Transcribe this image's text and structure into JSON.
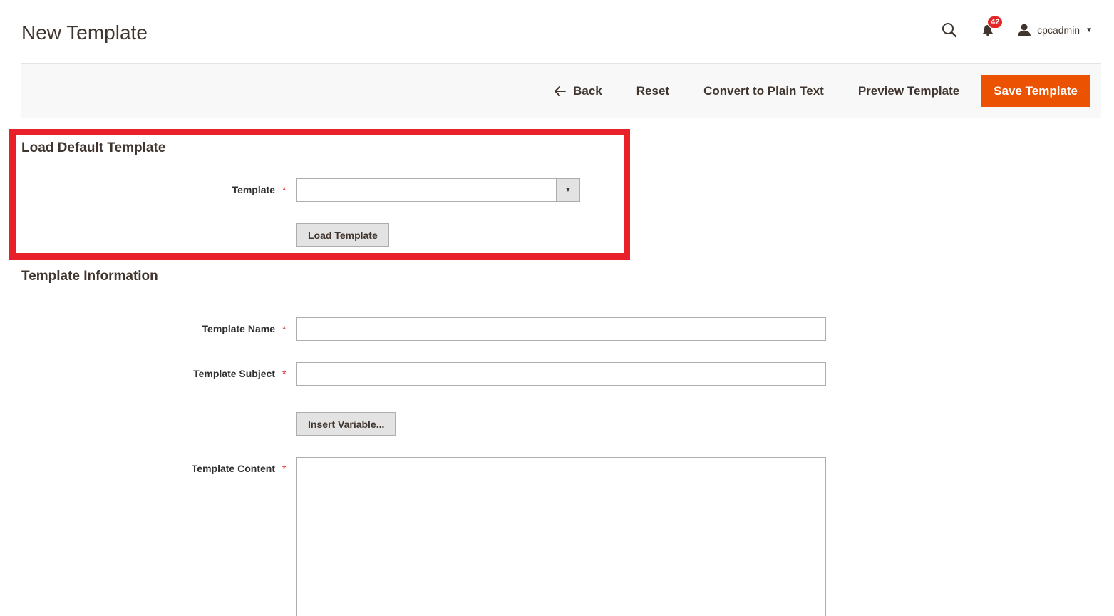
{
  "header": {
    "title": "New Template",
    "notifications_count": "42",
    "username": "cpcadmin"
  },
  "toolbar": {
    "back_label": "Back",
    "reset_label": "Reset",
    "convert_label": "Convert to Plain Text",
    "preview_label": "Preview Template",
    "save_label": "Save Template"
  },
  "load_default": {
    "section_title": "Load Default Template",
    "template_label": "Template",
    "template_value": "",
    "load_button": "Load Template"
  },
  "template_info": {
    "section_title": "Template Information",
    "name_label": "Template Name",
    "name_value": "",
    "subject_label": "Template Subject",
    "subject_value": "",
    "insert_variable_button": "Insert Variable...",
    "content_label": "Template Content",
    "content_value": ""
  },
  "required_marker": "*",
  "colors": {
    "primary_button": "#eb5202",
    "highlight_border": "#e8202a",
    "badge": "#e22626"
  }
}
